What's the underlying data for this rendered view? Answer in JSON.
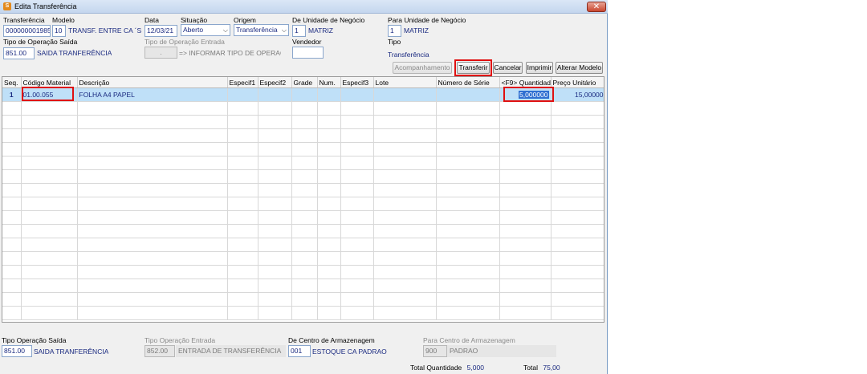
{
  "window": {
    "title": "Edita Transferência",
    "close_glyph": "✕",
    "icon_glyph": "S"
  },
  "header": {
    "transferencia_label": "Transferência",
    "transferencia_value": "000000001985",
    "modelo_label": "Modelo",
    "modelo_code": "10",
    "modelo_desc": "TRANSF. ENTRE CA ´S - M",
    "data_label": "Data",
    "data_value": "12/03/21",
    "situacao_label": "Situação",
    "situacao_value": "Aberto",
    "origem_label": "Origem",
    "origem_value": "Transferência",
    "de_unidade_label": "De Unidade de Negócio",
    "de_unidade_code": "1",
    "de_unidade_desc": "MATRIZ",
    "para_unidade_label": "Para Unidade de Negócio",
    "para_unidade_code": "1",
    "para_unidade_desc": "MATRIZ",
    "tipo_saida_label": "Tipo de Operação Saída",
    "tipo_saida_code": "851.00",
    "tipo_saida_desc": "SAIDA TRANFERÊNCIA",
    "tipo_entrada_label": "Tipo de Operação Entrada",
    "tipo_entrada_code": ".",
    "tipo_entrada_desc": "=> INFORMAR TIPO DE OPERACAO",
    "vendedor_label": "Vendedor",
    "vendedor_value": "",
    "tipo_label": "Tipo",
    "tipo_value": "Transferência"
  },
  "toolbar": {
    "acompanhamento": "Acompanhamento",
    "transferir": "Transferir",
    "cancelar": "Cancelar",
    "imprimir": "Imprimir",
    "alterar_modelo": "Alterar Modelo"
  },
  "grid": {
    "columns": [
      "Seq.",
      "Código Material",
      "Descrição",
      "Especif1",
      "Especif2",
      "Grade",
      "Num.",
      "Especif3",
      "Lote",
      "Número de Série",
      "<F9> Quantidade",
      "Preço Unitário"
    ],
    "rows": [
      {
        "seq": "1",
        "codigo": "01.00.055",
        "descricao": "FOLHA A4 PAPEL",
        "quantidade": "5,000000",
        "preco": "15,00000"
      }
    ]
  },
  "footer": {
    "tipo_saida_label": "Tipo Operação Saída",
    "tipo_saida_code": "851.00",
    "tipo_saida_desc": "SAIDA TRANFERÊNCIA",
    "tipo_entrada_label": "Tipo Operação Entrada",
    "tipo_entrada_code": "852.00",
    "tipo_entrada_desc": "ENTRADA DE TRANSFERÊNCIA",
    "de_centro_label": "De Centro de Armazenagem",
    "de_centro_code": "001",
    "de_centro_desc": "ESTOQUE CA PADRAO",
    "para_centro_label": "Para Centro de Armazenagem",
    "para_centro_code": "900",
    "para_centro_desc": "PADRAO",
    "total_qtd_label": "Total Quantidade",
    "total_qtd_value": "5,000",
    "total_label": "Total",
    "total_value": "75,00"
  },
  "colors": {
    "accent": "#1a2a80",
    "highlight": "#e01010",
    "selected_row": "#bfe0f8"
  }
}
